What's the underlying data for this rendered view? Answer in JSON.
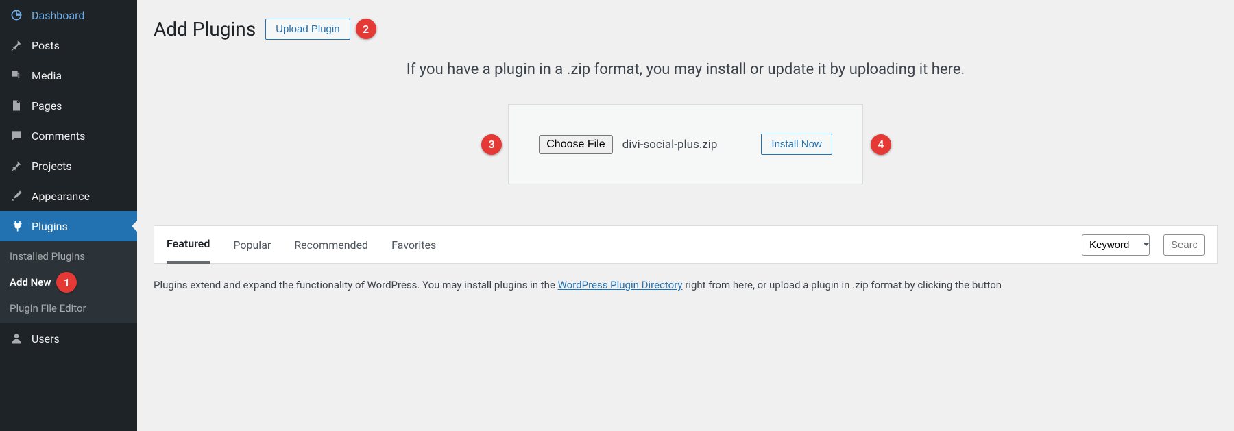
{
  "sidebar": {
    "items": [
      {
        "label": "Dashboard",
        "icon": "dashboard"
      },
      {
        "label": "Posts",
        "icon": "pin"
      },
      {
        "label": "Media",
        "icon": "media"
      },
      {
        "label": "Pages",
        "icon": "page"
      },
      {
        "label": "Comments",
        "icon": "comment"
      },
      {
        "label": "Projects",
        "icon": "pin"
      },
      {
        "label": "Appearance",
        "icon": "brush"
      },
      {
        "label": "Plugins",
        "icon": "plug",
        "active": true
      },
      {
        "label": "Users",
        "icon": "user"
      }
    ],
    "submenu": [
      {
        "label": "Installed Plugins"
      },
      {
        "label": "Add New",
        "current": true
      },
      {
        "label": "Plugin File Editor"
      }
    ]
  },
  "header": {
    "title": "Add Plugins",
    "upload_button": "Upload Plugin"
  },
  "upload": {
    "message": "If you have a plugin in a .zip format, you may install or update it by uploading it here.",
    "choose_file": "Choose File",
    "chosen_file": "divi-social-plus.zip",
    "install_now": "Install Now"
  },
  "filter": {
    "tabs": [
      "Featured",
      "Popular",
      "Recommended",
      "Favorites"
    ],
    "active_tab": 0,
    "select_label": "Keyword",
    "search_placeholder": "Search"
  },
  "description": {
    "prefix": "Plugins extend and expand the functionality of WordPress. You may install plugins in the ",
    "link": "WordPress Plugin Directory",
    "suffix": " right from here, or upload a plugin in .zip format by clicking the button"
  },
  "badges": {
    "b1": "1",
    "b2": "2",
    "b3": "3",
    "b4": "4"
  }
}
